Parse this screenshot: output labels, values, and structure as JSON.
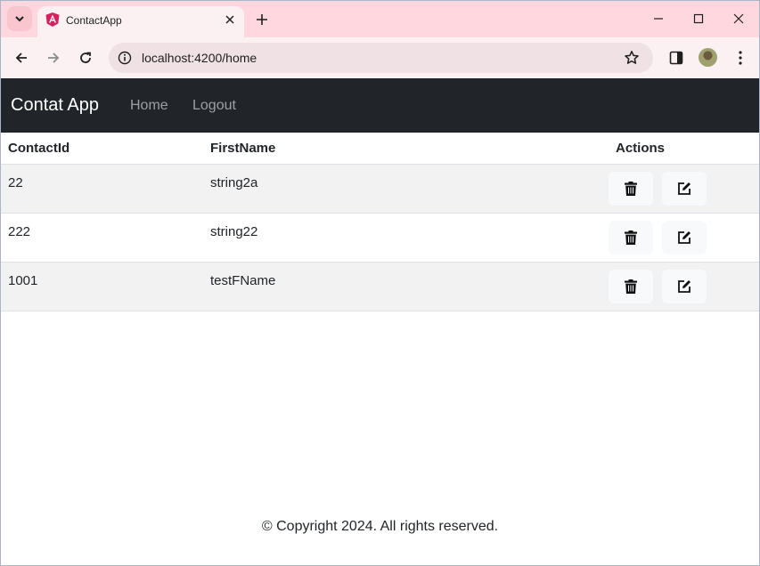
{
  "browser": {
    "tab_title": "ContactApp",
    "url": "localhost:4200/home"
  },
  "navbar": {
    "brand": "Contat App",
    "links": [
      "Home",
      "Logout"
    ]
  },
  "table": {
    "headers": [
      "ContactId",
      "FirstName",
      "Actions"
    ],
    "rows": [
      {
        "id": "22",
        "first_name": "string2a"
      },
      {
        "id": "222",
        "first_name": "string22"
      },
      {
        "id": "1001",
        "first_name": "testFName"
      }
    ]
  },
  "footer": {
    "text": "© Copyright 2024. All rights reserved."
  },
  "colors": {
    "tabstrip": "#ffd8df",
    "navbar": "#212529",
    "striped_row": "#f2f2f2"
  }
}
